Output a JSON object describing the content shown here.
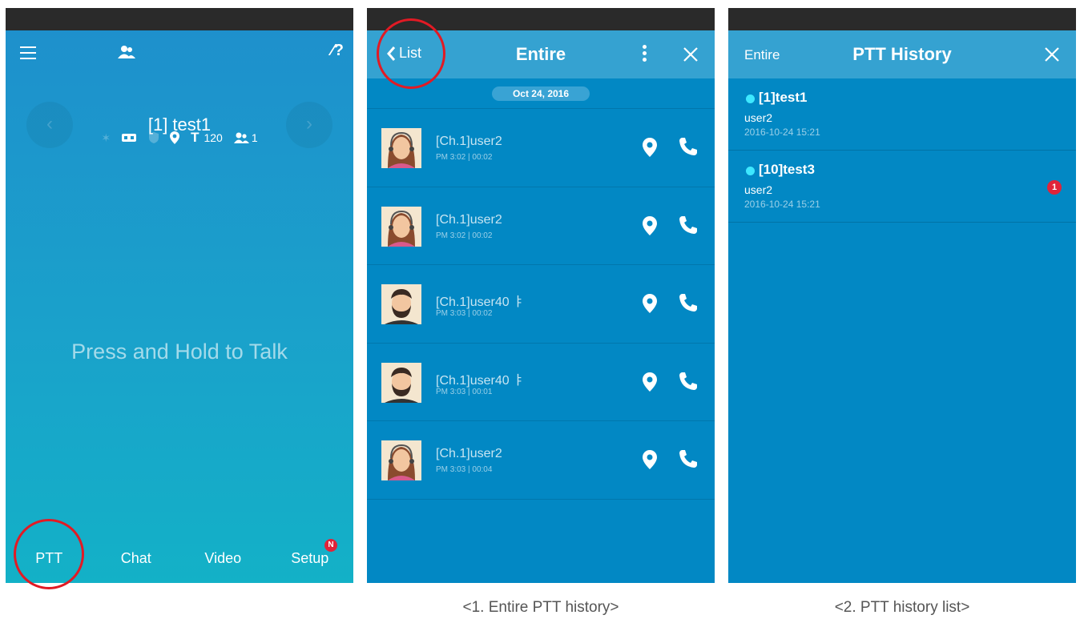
{
  "phone1": {
    "channel_name": "[1] test1",
    "t_count": "120",
    "member_count": "1",
    "ptt_prompt": "Press and Hold to Talk",
    "tabs": [
      "PTT",
      "Chat",
      "Video",
      "Setup"
    ],
    "setup_badge": "N",
    "icons": [
      "menu-icon",
      "contacts-icon",
      "unlink-icon",
      "bluetooth-icon",
      "battery-icon",
      "shield-icon",
      "location-icon",
      "text-icon",
      "members-icon"
    ]
  },
  "phone2": {
    "back_label": "List",
    "title": "Entire",
    "date": "Oct 24, 2016",
    "items": [
      {
        "name": "[Ch.1]user2",
        "meta": "PM 3:02 | 00:02",
        "avatar": "female"
      },
      {
        "name": "[Ch.1]user2",
        "meta": "PM 3:02 | 00:02",
        "avatar": "female"
      },
      {
        "name": "[Ch.1]user40 ㅑ",
        "meta": "PM 3:03 | 00:02",
        "avatar": "male"
      },
      {
        "name": "[Ch.1]user40 ㅑ",
        "meta": "PM 3:03 | 00:01",
        "avatar": "male"
      },
      {
        "name": "[Ch.1]user2",
        "meta": "PM 3:03 | 00:04",
        "avatar": "female"
      }
    ]
  },
  "phone3": {
    "left_label": "Entire",
    "title": "PTT History",
    "rooms": [
      {
        "name": "[1]test1",
        "user": "user2",
        "time": "2016-10-24 15:21",
        "unread": ""
      },
      {
        "name": "[10]test3",
        "user": "user2",
        "time": "2016-10-24 15:21",
        "unread": "1"
      }
    ]
  },
  "captions": {
    "first": "<1. Entire PTT history>",
    "second": "<2. PTT history list>"
  },
  "colors": {
    "header_blue": "#35a2d1",
    "body_blue": "#0288c4",
    "annotation_red": "#e21a24",
    "badge_red": "#e0243a",
    "online_dot": "#3ee8ff"
  }
}
